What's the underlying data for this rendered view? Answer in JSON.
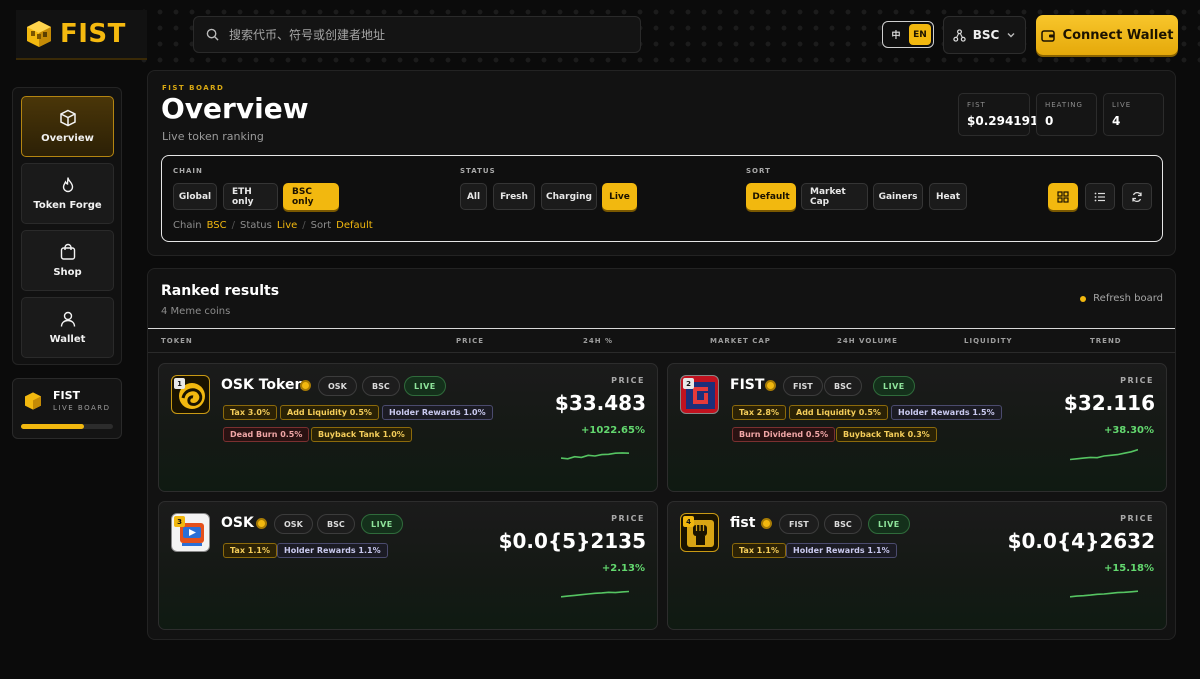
{
  "brand": {
    "name": "FIST"
  },
  "search": {
    "placeholder": "搜索代币、符号或创建者地址"
  },
  "lang": {
    "zh": "中",
    "en": "EN",
    "active": "EN"
  },
  "network": {
    "label": "BSC"
  },
  "connect": {
    "label": "Connect Wallet"
  },
  "sidebar": {
    "items": [
      {
        "label": "Overview",
        "icon": "cube-icon",
        "active": true
      },
      {
        "label": "Token Forge",
        "icon": "flame-icon",
        "active": false
      },
      {
        "label": "Shop",
        "icon": "bag-icon",
        "active": false
      },
      {
        "label": "Wallet",
        "icon": "user-icon",
        "active": false
      }
    ],
    "card": {
      "title": "FIST",
      "subtitle": "LIVE BOARD",
      "progress": 0.68
    }
  },
  "overview": {
    "kicker": "FIST BOARD",
    "title": "Overview",
    "subtitle": "Live token ranking",
    "stats": [
      {
        "label": "FIST",
        "value": "$0.294191"
      },
      {
        "label": "HEATING",
        "value": "0"
      },
      {
        "label": "LIVE",
        "value": "4"
      }
    ]
  },
  "filters": {
    "chain": {
      "label": "CHAIN",
      "options": [
        "Global",
        "ETH only",
        "BSC only"
      ],
      "active": "BSC only"
    },
    "status": {
      "label": "STATUS",
      "options": [
        "All",
        "Fresh",
        "Charging",
        "Live"
      ],
      "active": "Live"
    },
    "sort": {
      "label": "SORT",
      "options": [
        "Default",
        "Market Cap",
        "Gainers",
        "Heat"
      ],
      "active": "Default"
    },
    "crumbs": {
      "chain_label": "Chain",
      "chain_value": "BSC",
      "status_label": "Status",
      "status_value": "Live",
      "sort_label": "Sort",
      "sort_value": "Default",
      "sep": "/"
    },
    "view": {
      "active": "grid"
    }
  },
  "ranked": {
    "title": "Ranked results",
    "subtitle": "4 Meme coins",
    "refresh": "Refresh board",
    "columns": [
      "TOKEN",
      "PRICE",
      "24H %",
      "MARKET CAP",
      "24H VOLUME",
      "LIQUIDITY",
      "TREND"
    ]
  },
  "tokens": [
    {
      "rank": "1",
      "name": "OSK Token",
      "symbol": "OSK",
      "chain": "BSC",
      "status": "LIVE",
      "tags": [
        "Tax 3.0%",
        "Add Liquidity 0.5%",
        "Holder Rewards 1.0%",
        "Dead Burn 0.5%",
        "Buyback Tank 1.0%"
      ],
      "price_label": "PRICE",
      "price": "$33.483",
      "change": "+1022.65%",
      "trend": [
        0.35,
        0.3,
        0.45,
        0.4,
        0.55,
        0.5,
        0.6,
        0.62,
        0.7,
        0.72,
        0.7
      ]
    },
    {
      "rank": "2",
      "name": "FIST",
      "symbol": "FIST",
      "chain": "BSC",
      "status": "LIVE",
      "tags": [
        "Tax 2.8%",
        "Add Liquidity 0.5%",
        "Holder Rewards 1.5%",
        "Burn Dividend 0.5%",
        "Buyback Tank 0.3%"
      ],
      "price_label": "PRICE",
      "price": "$32.116",
      "change": "+38.30%",
      "trend": [
        0.25,
        0.3,
        0.35,
        0.4,
        0.38,
        0.5,
        0.55,
        0.6,
        0.7,
        0.8,
        0.95
      ]
    },
    {
      "rank": "3",
      "name": "OSK",
      "symbol": "OSK",
      "chain": "BSC",
      "status": "LIVE",
      "tags": [
        "Tax 1.1%",
        "Holder Rewards 1.1%"
      ],
      "price_label": "PRICE",
      "price": "$0.0{5}2135",
      "change": "+2.13%",
      "trend": [
        0.3,
        0.35,
        0.4,
        0.45,
        0.5,
        0.55,
        0.58,
        0.62,
        0.6,
        0.65,
        0.68
      ]
    },
    {
      "rank": "4",
      "name": "fist",
      "symbol": "FIST",
      "chain": "BSC",
      "status": "LIVE",
      "tags": [
        "Tax 1.1%",
        "Holder Rewards 1.1%"
      ],
      "price_label": "PRICE",
      "price": "$0.0{4}2632",
      "change": "+15.18%",
      "trend": [
        0.3,
        0.35,
        0.38,
        0.42,
        0.48,
        0.5,
        0.55,
        0.6,
        0.62,
        0.66,
        0.7
      ]
    }
  ],
  "colors": {
    "accent": "#f2b80f",
    "positive": "#63d86f",
    "bg": "#0b0b0b"
  }
}
